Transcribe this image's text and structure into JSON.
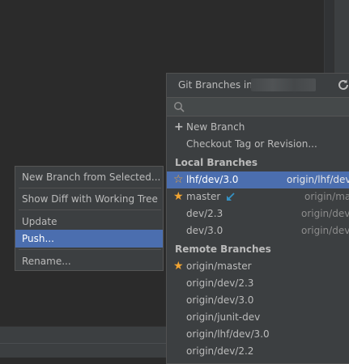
{
  "popup": {
    "title": "Git Branches in",
    "search_placeholder": "",
    "actions": [
      {
        "label": "New Branch",
        "icon": "plus-icon"
      },
      {
        "label": "Checkout Tag or Revision..."
      }
    ],
    "local_header": "Local Branches",
    "local": [
      {
        "name": "lhf/dev/3.0",
        "remote": "origin/lhf/dev/",
        "star": "hollow",
        "selected": true
      },
      {
        "name": "master",
        "remote": "origin/mast",
        "star": "filled",
        "current": true
      },
      {
        "name": "dev/2.3",
        "remote": "origin/dev/"
      },
      {
        "name": "dev/3.0",
        "remote": "origin/dev/"
      }
    ],
    "remote_header": "Remote Branches",
    "remote": [
      {
        "name": "origin/master",
        "star": "filled"
      },
      {
        "name": "origin/dev/2.3"
      },
      {
        "name": "origin/dev/3.0"
      },
      {
        "name": "origin/junit-dev"
      },
      {
        "name": "origin/lhf/dev/3.0"
      },
      {
        "name": "origin/dev/2.2"
      }
    ]
  },
  "context_menu": {
    "items": [
      {
        "label": "New Branch from Selected..."
      },
      {
        "label": "Show Diff with Working Tree"
      },
      {
        "label": "Update"
      },
      {
        "label": "Push...",
        "selected": true
      },
      {
        "label": "Rename..."
      }
    ]
  },
  "colors": {
    "selection": "#4b6eaf",
    "star": "#f2a532",
    "current_arrow": "#3592c4"
  }
}
